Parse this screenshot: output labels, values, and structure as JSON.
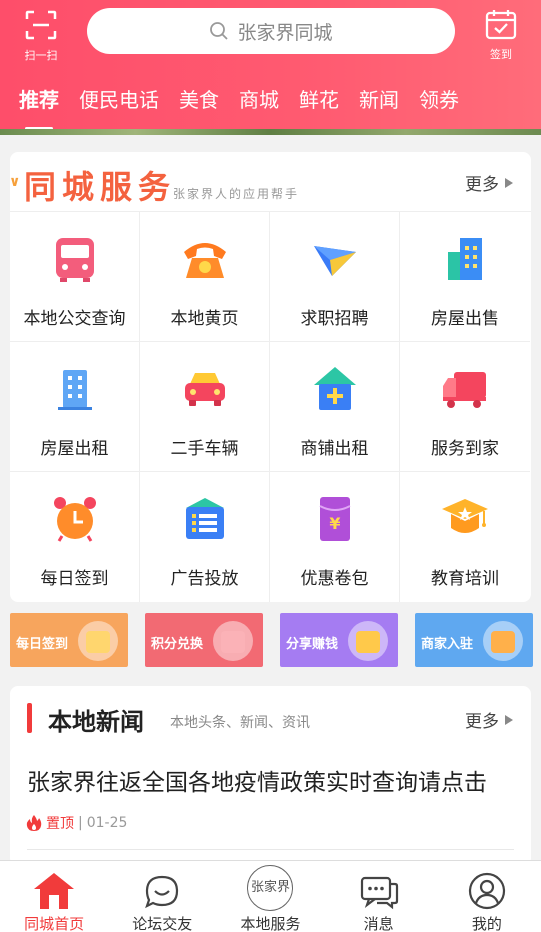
{
  "header": {
    "scan_label": "扫一扫",
    "search_placeholder": "张家界同城",
    "checkin_label": "签到",
    "tabs": [
      {
        "label": "推荐"
      },
      {
        "label": "便民电话"
      },
      {
        "label": "美食"
      },
      {
        "label": "商城"
      },
      {
        "label": "鲜花"
      },
      {
        "label": "新闻"
      },
      {
        "label": "领券"
      }
    ],
    "colors": {
      "accent": "#fe4e6a"
    }
  },
  "services": {
    "title": "同城服务",
    "subtitle": "张家界人的应用帮手",
    "more_label": "更多",
    "items": [
      {
        "label": "本地公交查询",
        "icon": "bus-icon"
      },
      {
        "label": "本地黄页",
        "icon": "phone-icon"
      },
      {
        "label": "求职招聘",
        "icon": "paper-plane-icon"
      },
      {
        "label": "房屋出售",
        "icon": "building-icon"
      },
      {
        "label": "房屋出租",
        "icon": "apartment-icon"
      },
      {
        "label": "二手车辆",
        "icon": "car-icon"
      },
      {
        "label": "商铺出租",
        "icon": "shop-house-icon"
      },
      {
        "label": "服务到家",
        "icon": "truck-icon"
      },
      {
        "label": "每日签到",
        "icon": "alarm-clock-icon"
      },
      {
        "label": "广告投放",
        "icon": "ad-list-icon"
      },
      {
        "label": "优惠卷包",
        "icon": "coupon-wallet-icon"
      },
      {
        "label": "教育培训",
        "icon": "graduation-cap-icon"
      }
    ]
  },
  "banners": [
    {
      "label": "每日签到",
      "color": "#f7a55d"
    },
    {
      "label": "积分兑换",
      "color": "#f26a73"
    },
    {
      "label": "分享赚钱",
      "color": "#a57cf2"
    },
    {
      "label": "商家入驻",
      "color": "#5fa8f0"
    }
  ],
  "news": {
    "title": "本地新闻",
    "subtitle": "本地头条、新闻、资讯",
    "more_label": "更多",
    "headline": "张家界往返全国各地疫情政策实时查询请点击",
    "pin_label": "置顶",
    "separator": "|",
    "date": "01-25"
  },
  "bottom_nav": [
    {
      "label": "同城首页",
      "icon": "home-icon",
      "active": true
    },
    {
      "label": "论坛交友",
      "icon": "chat-smile-icon",
      "active": false
    },
    {
      "label": "本地服务",
      "icon": "city-badge-icon",
      "badge_text": "张家界",
      "active": false
    },
    {
      "label": "消息",
      "icon": "message-icon",
      "active": false
    },
    {
      "label": "我的",
      "icon": "user-icon",
      "active": false
    }
  ]
}
